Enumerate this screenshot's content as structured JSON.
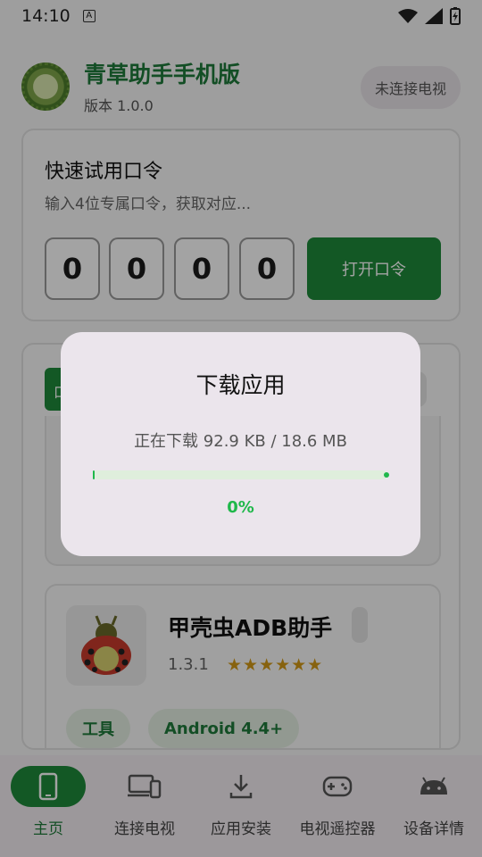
{
  "status_bar": {
    "time": "14:10",
    "a_badge": "A"
  },
  "header": {
    "title": "青草助手手机版",
    "version": "版本 1.0.0",
    "connect_status": "未连接电视"
  },
  "passcode": {
    "title": "快速试用口令",
    "subtitle": "输入4位专属口令，获取对应...",
    "digits": [
      "0",
      "0",
      "0",
      "0"
    ],
    "open_button": "打开口令"
  },
  "apps": {
    "partial_tab": "口",
    "items": [
      {
        "name": "甲壳虫ADB助手",
        "version": "1.3.1",
        "rating": 6,
        "stars": "★★★★★★",
        "tags": [
          "工具",
          "Android 4.4+"
        ]
      }
    ]
  },
  "bottom_nav": [
    {
      "label": "主页",
      "icon": "phone-icon",
      "active": true
    },
    {
      "label": "连接电视",
      "icon": "devices-icon",
      "active": false
    },
    {
      "label": "应用安装",
      "icon": "download-icon",
      "active": false
    },
    {
      "label": "电视遥控器",
      "icon": "gamepad-icon",
      "active": false
    },
    {
      "label": "设备详情",
      "icon": "android-icon",
      "active": false
    }
  ],
  "dialog": {
    "title": "下载应用",
    "message": "正在下载 92.9 KB / 18.6 MB",
    "progress_percent_label": "0%",
    "progress_fraction": 0.005
  },
  "colors": {
    "accent": "#1f8a3a",
    "progress": "#1fb84a",
    "star": "#d39a16"
  }
}
